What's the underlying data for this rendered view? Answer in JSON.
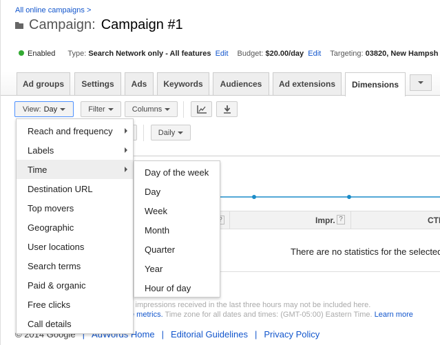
{
  "breadcrumb": "All online campaigns >",
  "title": {
    "label": "Campaign:",
    "name": "Campaign #1"
  },
  "status": {
    "state": "Enabled",
    "type_label": "Type:",
    "type_value": "Search Network only - All features",
    "edit": "Edit",
    "budget_label": "Budget:",
    "budget_value": "$20.00/day",
    "targeting_label": "Targeting:",
    "targeting_value": "03820, New Hampsh"
  },
  "tabs": [
    "Ad groups",
    "Settings",
    "Ads",
    "Keywords",
    "Audiences",
    "Ad extensions",
    "Dimensions"
  ],
  "toolbar": {
    "view_prefix": "View:",
    "view_value": "Day",
    "filter": "Filter",
    "columns": "Columns",
    "daily": "Daily"
  },
  "menu": [
    "Reach and frequency",
    "Labels",
    "Time",
    "Destination URL",
    "Top movers",
    "Geographic",
    "User locations",
    "Search terms",
    "Paid & organic",
    "Free clicks",
    "Call details"
  ],
  "submenu": [
    "Day of the week",
    "Day",
    "Week",
    "Month",
    "Quarter",
    "Year",
    "Hour of day"
  ],
  "table": {
    "headers": [
      "Impr.",
      "CTR"
    ],
    "help": "?",
    "empty": "There are no statistics for the selected"
  },
  "notes": {
    "line1": "l impressions received in the last three hours may not be included here.",
    "line2_link": "e metrics.",
    "line2": " Time zone for all dates and times: (GMT-05:00) Eastern Time.",
    "learn_more": "Learn more"
  },
  "footer": {
    "copyright": "© 2014 Google",
    "links": [
      "AdWords Home",
      "Editorial Guidelines",
      "Privacy Policy"
    ]
  },
  "colors": {
    "link": "#1155cc",
    "enabled": "#33aa33",
    "chart_line": "#1a8cc8"
  }
}
